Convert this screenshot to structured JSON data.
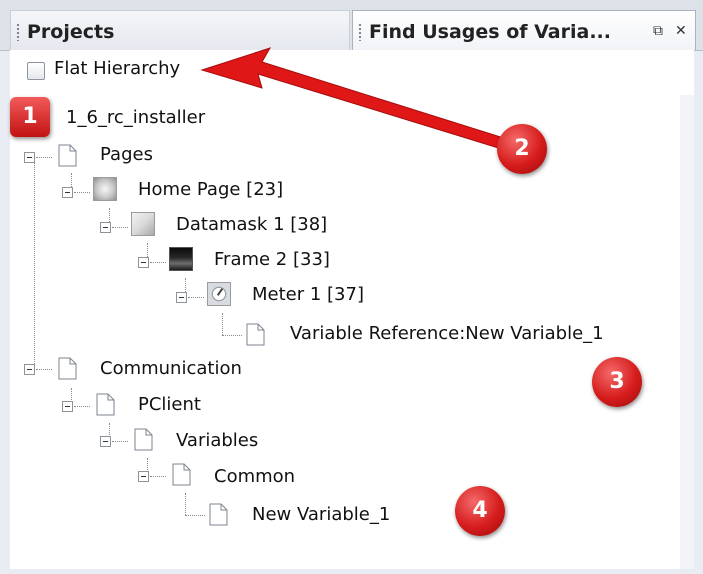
{
  "tabs": [
    {
      "label": "Projects",
      "active": false
    },
    {
      "label": "Find Usages of Varia...",
      "active": true
    }
  ],
  "icons": {
    "restore": "restore-window-icon",
    "close": "close-icon"
  },
  "options": {
    "flat_hierarchy_label": "Flat Hierarchy",
    "flat_hierarchy_checked": false
  },
  "tree": {
    "root": "1_6_rc_installer",
    "pages": "Pages",
    "home_page": "Home Page [23]",
    "datamask": "Datamask 1 [38]",
    "frame": "Frame 2 [33]",
    "meter": "Meter 1 [37]",
    "variable_reference": "Variable Reference:New Variable_1",
    "communication": "Communication",
    "pclient": "PClient",
    "variables": "Variables",
    "common": "Common",
    "new_variable": "New Variable_1"
  },
  "annotations": {
    "b1": "1",
    "b2": "2",
    "b3": "3",
    "b4": "4"
  },
  "colors": {
    "annotation_red": "#d61c1c",
    "panel_bg": "#e9ecf2"
  }
}
